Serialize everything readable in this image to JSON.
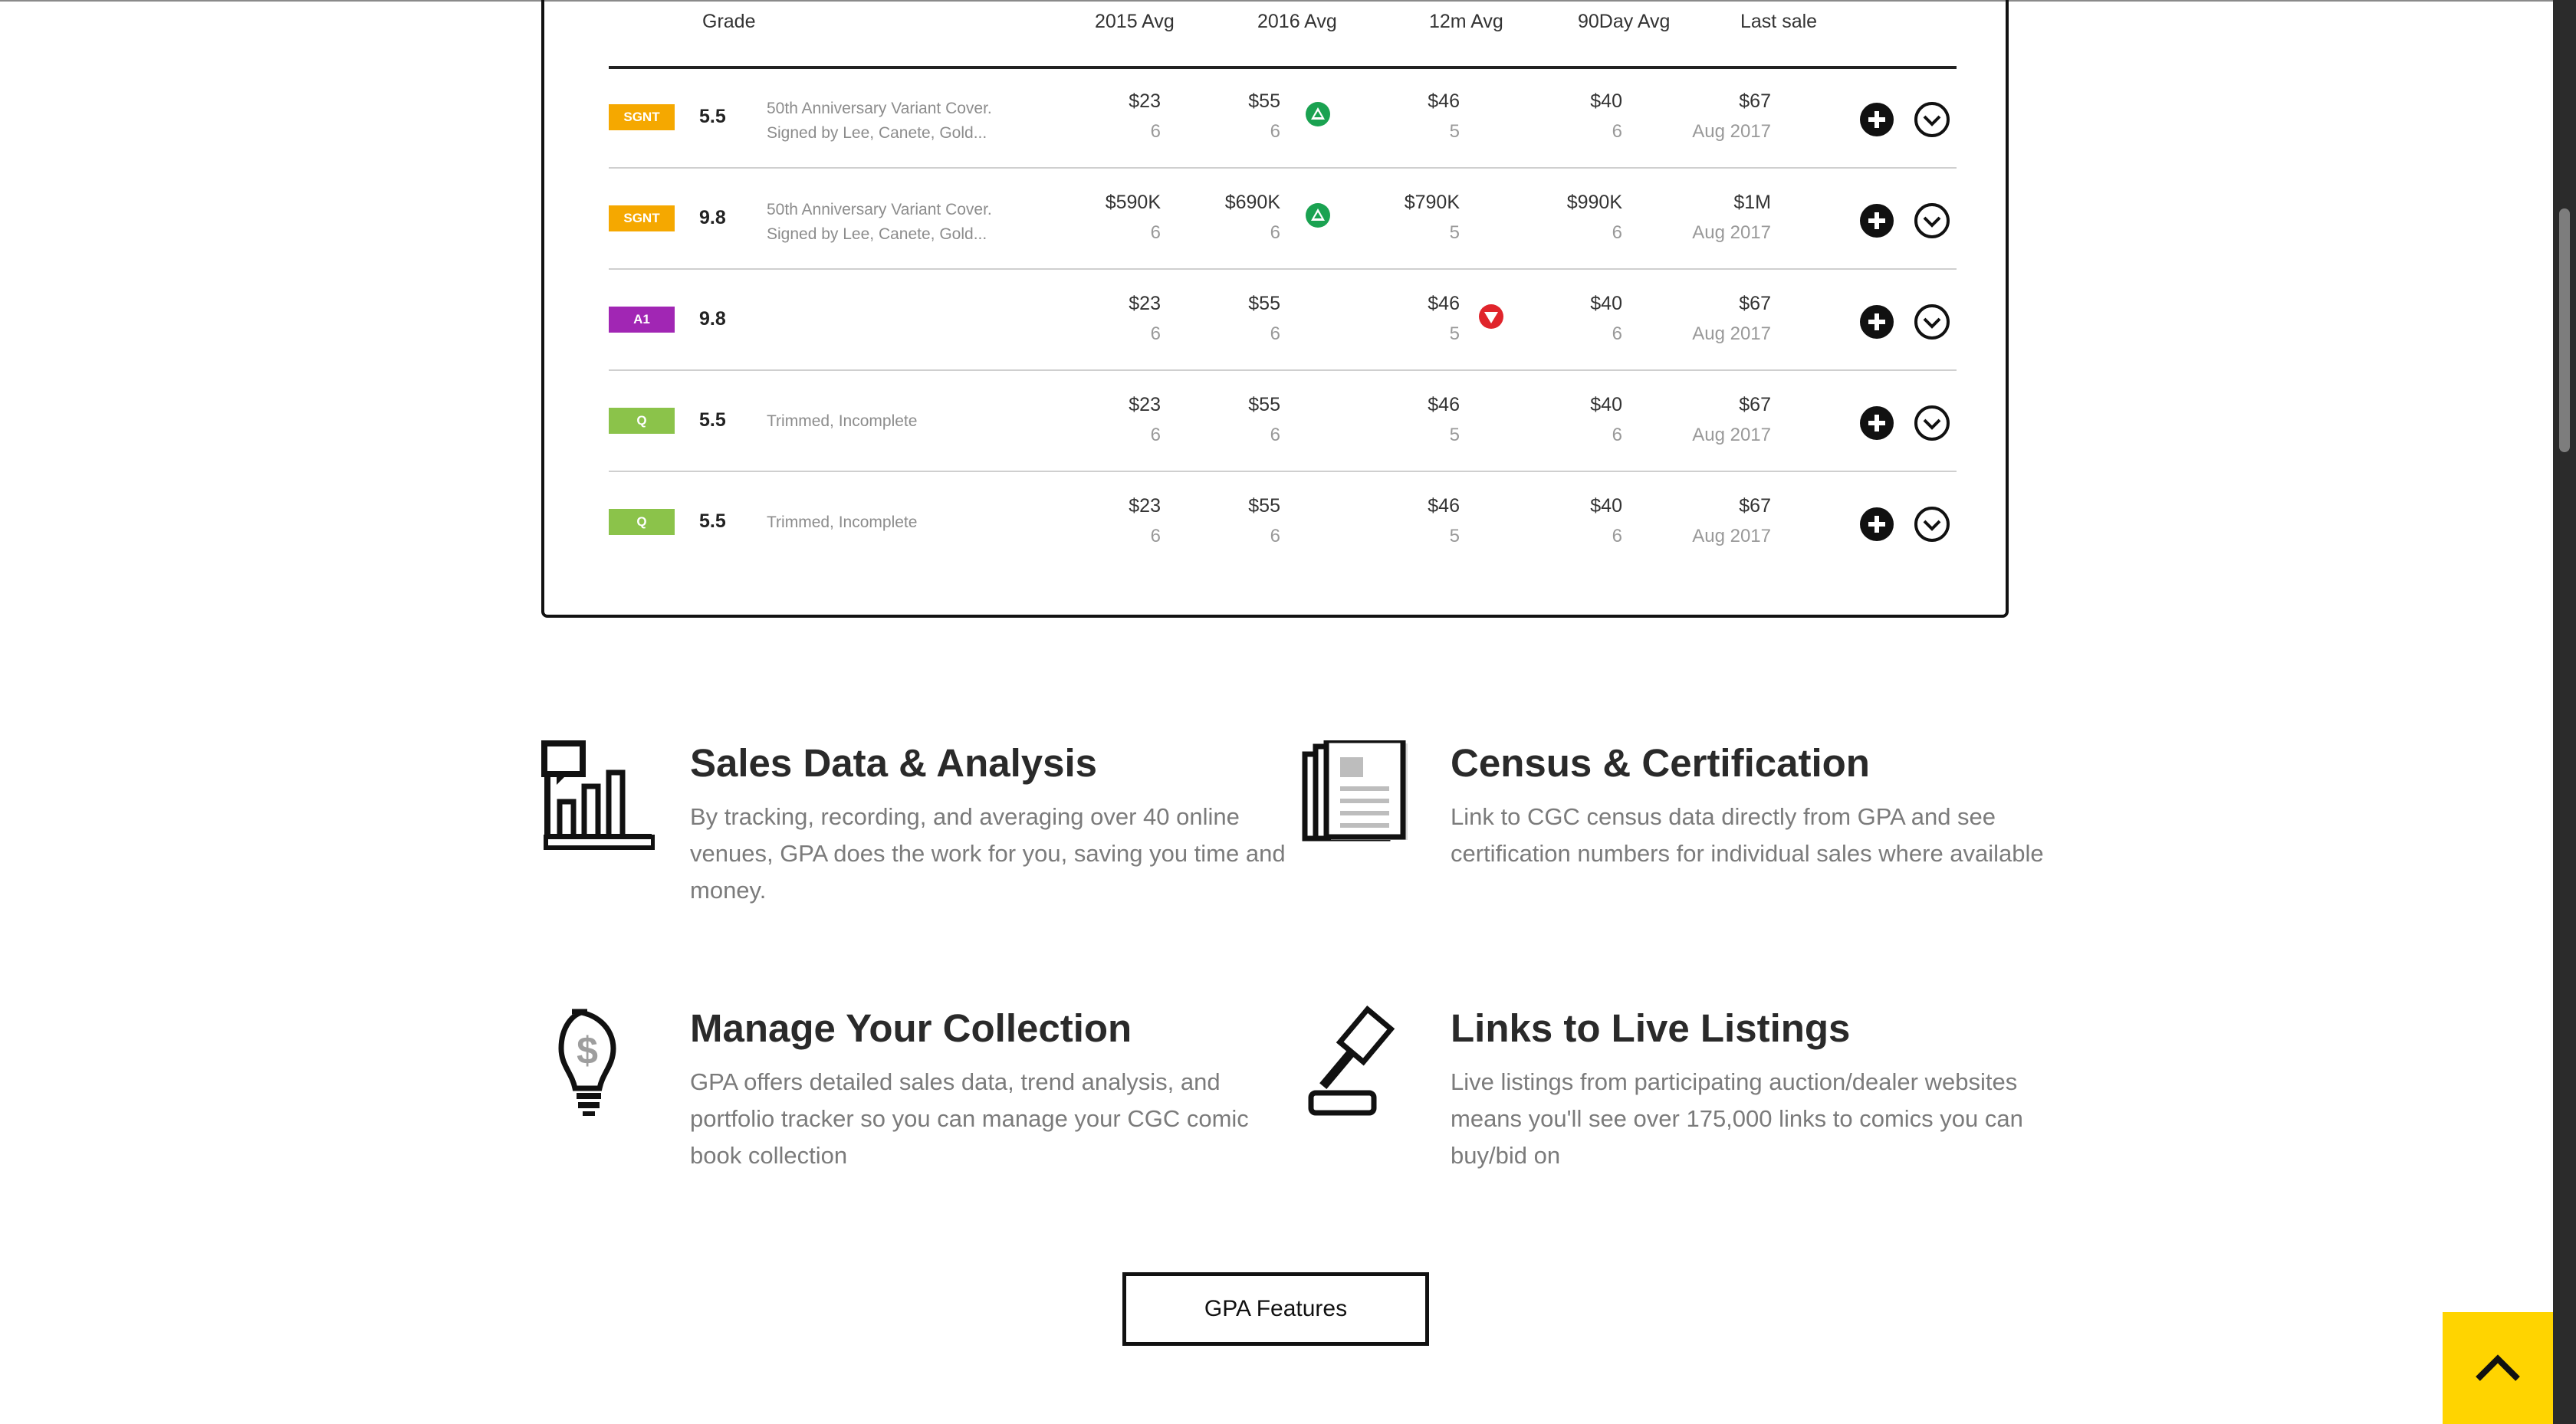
{
  "table": {
    "headers": {
      "grade": "Grade",
      "avg2015": "2015 Avg",
      "avg2016": "2016 Avg",
      "avg12m": "12m Avg",
      "avg90": "90Day Avg",
      "last_sale": "Last sale"
    },
    "rows": [
      {
        "tag": "SGNT",
        "tag_color": "#f5a800",
        "grade": "5.5",
        "note_line1": "50th Anniversary Variant Cover.",
        "note_line2": "Signed by Lee, Canete, Gold...",
        "avg2015": "$23",
        "cnt2015": "6",
        "avg2016": "$55",
        "cnt2016": "6",
        "avg12m": "$46",
        "cnt12m": "5",
        "avg90": "$40",
        "cnt90": "6",
        "last_value": "$67",
        "last_date": "Aug 2017",
        "trend": "up-2016"
      },
      {
        "tag": "SGNT",
        "tag_color": "#f5a800",
        "grade": "9.8",
        "note_line1": "50th Anniversary Variant Cover.",
        "note_line2": "Signed by Lee, Canete, Gold...",
        "avg2015": "$590K",
        "cnt2015": "6",
        "avg2016": "$690K",
        "cnt2016": "6",
        "avg12m": "$790K",
        "cnt12m": "5",
        "avg90": "$990K",
        "cnt90": "6",
        "last_value": "$1M",
        "last_date": "Aug 2017",
        "trend": "up-2016"
      },
      {
        "tag": "A1",
        "tag_color": "#a126b4",
        "grade": "9.8",
        "note_line1": "",
        "note_line2": "",
        "avg2015": "$23",
        "cnt2015": "6",
        "avg2016": "$55",
        "cnt2016": "6",
        "avg12m": "$46",
        "cnt12m": "5",
        "avg90": "$40",
        "cnt90": "6",
        "last_value": "$67",
        "last_date": "Aug 2017",
        "trend": "down-12m"
      },
      {
        "tag": "Q",
        "tag_color": "#8bc34a",
        "grade": "5.5",
        "note_line1": "Trimmed, Incomplete",
        "note_line2": "",
        "avg2015": "$23",
        "cnt2015": "6",
        "avg2016": "$55",
        "cnt2016": "6",
        "avg12m": "$46",
        "cnt12m": "5",
        "avg90": "$40",
        "cnt90": "6",
        "last_value": "$67",
        "last_date": "Aug 2017",
        "trend": "none"
      },
      {
        "tag": "Q",
        "tag_color": "#8bc34a",
        "grade": "5.5",
        "note_line1": "Trimmed, Incomplete",
        "note_line2": "",
        "avg2015": "$23",
        "cnt2015": "6",
        "avg2016": "$55",
        "cnt2016": "6",
        "avg12m": "$46",
        "cnt12m": "5",
        "avg90": "$40",
        "cnt90": "6",
        "last_value": "$67",
        "last_date": "Aug 2017",
        "trend": "none"
      }
    ],
    "colors": {
      "trend_up": "#1aa251",
      "trend_down": "#e0242b"
    }
  },
  "features": [
    {
      "title": "Sales Data & Analysis",
      "text": "By tracking, recording, and averaging over 40 online venues, GPA does the work for you, saving you time and money.",
      "icon": "bar-chart-icon"
    },
    {
      "title": "Census & Certification",
      "text": "Link to CGC census data directly from GPA and see certification numbers for individual sales where available",
      "icon": "document-icon"
    },
    {
      "title": "Manage Your Collection",
      "text": "GPA offers detailed sales data, trend analysis, and portfolio tracker so you can manage your CGC comic book collection",
      "icon": "lightbulb-dollar-icon"
    },
    {
      "title": "Links to Live Listings",
      "text": "Live listings from participating auction/dealer websites means you'll see over 175,000 links to comics you can buy/bid on",
      "icon": "gavel-icon"
    }
  ],
  "cta": {
    "label": "GPA Features"
  },
  "back_to_top": {
    "icon": "chevron-up-icon",
    "color": "#ffd400"
  }
}
